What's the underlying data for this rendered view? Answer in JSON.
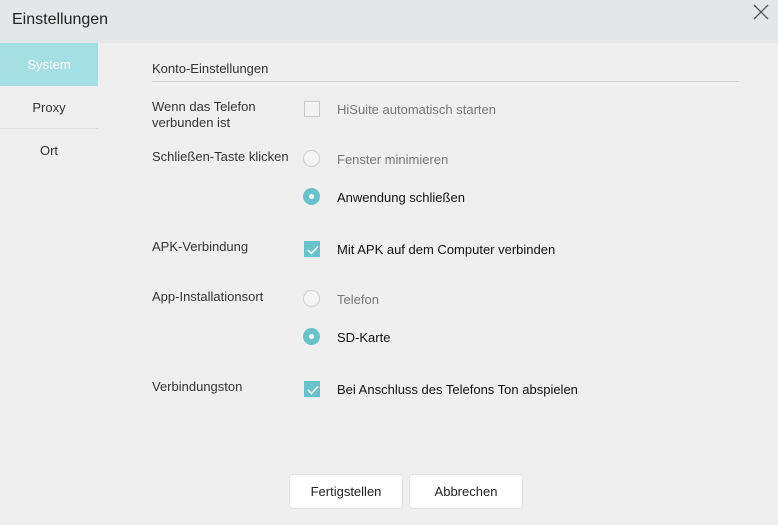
{
  "window": {
    "title": "Einstellungen"
  },
  "sidebar": {
    "items": [
      {
        "label": "System",
        "active": true
      },
      {
        "label": "Proxy",
        "active": false
      },
      {
        "label": "Ort",
        "active": false
      }
    ]
  },
  "section": {
    "title": "Konto-Einstellungen"
  },
  "settings": {
    "phone_connected": {
      "label_line1": "Wenn das Telefon",
      "label_line2": "verbunden ist",
      "checkbox_label": "HiSuite automatisch starten",
      "checked": false
    },
    "close_button": {
      "label": "Schließen-Taste klicken",
      "options": [
        {
          "label": "Fenster minimieren",
          "selected": false
        },
        {
          "label": "Anwendung schließen",
          "selected": true
        }
      ]
    },
    "apk": {
      "label": "APK-Verbindung",
      "checkbox_label": "Mit APK auf dem Computer verbinden",
      "checked": true
    },
    "install_location": {
      "label": "App-Installationsort",
      "options": [
        {
          "label": "Telefon",
          "selected": false
        },
        {
          "label": "SD-Karte",
          "selected": true
        }
      ]
    },
    "sound": {
      "label": "Verbindungston",
      "checkbox_label": "Bei Anschluss des Telefons Ton abspielen",
      "checked": true
    }
  },
  "buttons": {
    "finish": "Fertigstellen",
    "cancel": "Abbrechen"
  },
  "colors": {
    "accent": "#68c2c9",
    "sidebar_active": "#a6dfe3",
    "titlebar": "#e4e6e7",
    "background": "#efefef"
  },
  "icons": {
    "close": "close-icon",
    "check": "checkmark-icon"
  }
}
